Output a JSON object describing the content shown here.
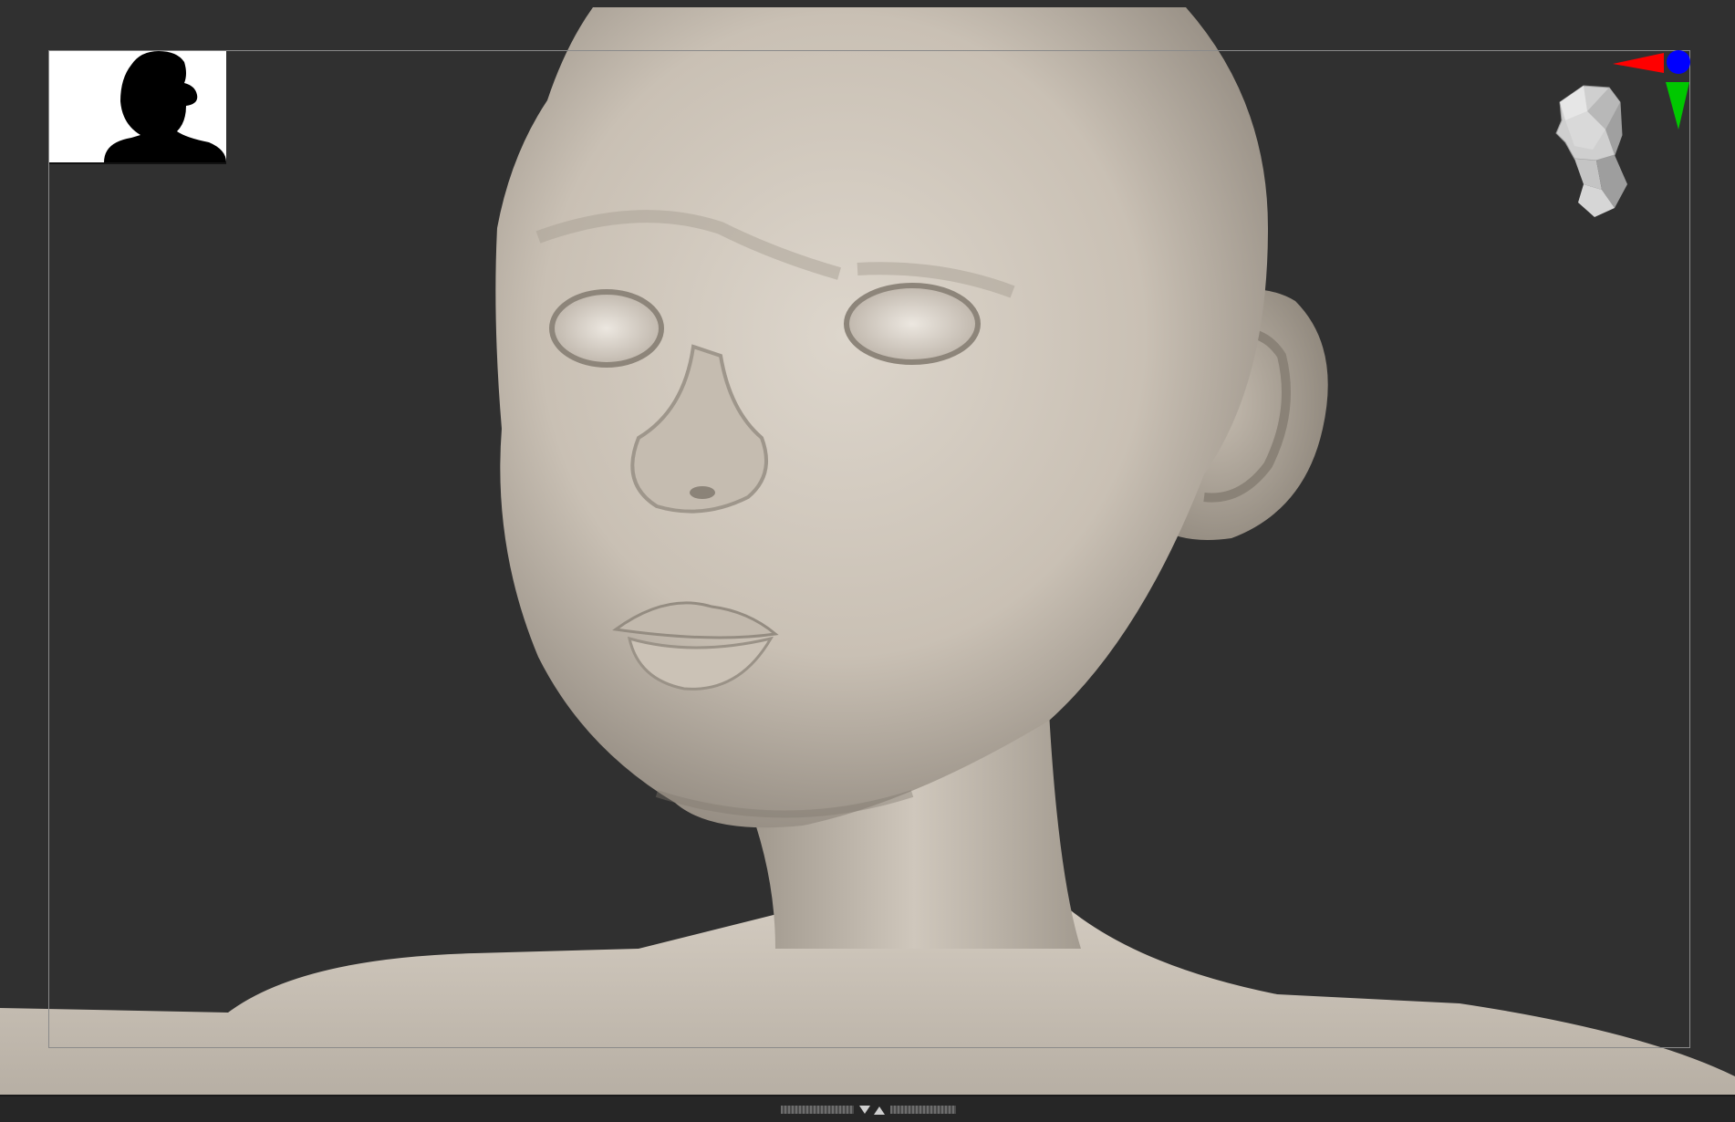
{
  "viewport": {
    "background_color": "#303030",
    "model_skin_color": "#cdc5bb",
    "frame_color": "#8a8a8a"
  },
  "thumbnail": {
    "icon": "silhouette-icon",
    "background_color": "#ffffff",
    "silhouette_color": "#000000"
  },
  "navigation_gizmo": {
    "icon": "head-orientation-icon",
    "axes": [
      {
        "axis": "x",
        "color": "#ff0000"
      },
      {
        "axis": "y",
        "color": "#00c800"
      },
      {
        "axis": "z",
        "color": "#0000ff"
      }
    ]
  },
  "bottom_bar": {
    "toggle_icon": "collapse-expand-icon"
  }
}
